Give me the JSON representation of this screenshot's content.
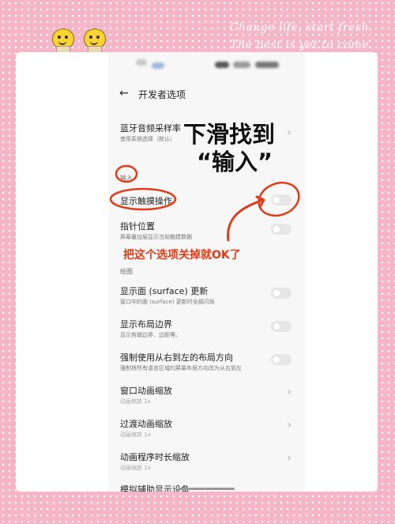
{
  "decor": {
    "line1": "Change life, start fresh.",
    "line2": "The best is yet to come."
  },
  "header": {
    "back_icon": "back-arrow-icon",
    "title": "开发者选项"
  },
  "rows": {
    "bt_sample": {
      "title": "蓝牙音频采样率",
      "sub": "使用系统选择（默认）"
    },
    "show_touch": {
      "title": "显示触摸操作"
    },
    "pointer": {
      "title": "指针位置",
      "sub": "屏幕叠加层显示当前触摸数据"
    },
    "surface": {
      "title": "显示面 (surface) 更新",
      "sub": "窗口中的面 (surface) 更新时全部闪烁"
    },
    "layout_bounds": {
      "title": "显示布局边界",
      "sub": "显示剪辑边界、边距等。"
    },
    "rtl": {
      "title": "强制使用从右到左的布局方向",
      "sub": "强制将所有语言区域的屏幕布局方向改为从右到左"
    },
    "window_anim": {
      "title": "窗口动画缩放",
      "sub": "动画缩放 1x"
    },
    "transition_anim": {
      "title": "过渡动画缩放",
      "sub": "动画缩放 1x"
    },
    "animator_duration": {
      "title": "动画程序时长缩放",
      "sub": "动画缩放 1x"
    },
    "simulate_display": {
      "title": "模拟辅助显示设备"
    }
  },
  "sections": {
    "input": "输入",
    "drawing": "绘图"
  },
  "toggles": {
    "show_touch": false,
    "pointer": false,
    "surface": false,
    "layout_bounds": false,
    "rtl": false
  },
  "annotations": {
    "scroll_line1": "下滑找到",
    "scroll_line2": "“输入”",
    "turn_off": "把这个选项关掉就OK了"
  },
  "colors": {
    "background_pink": "#f4b6c8",
    "annotation_red": "#e13a16"
  }
}
